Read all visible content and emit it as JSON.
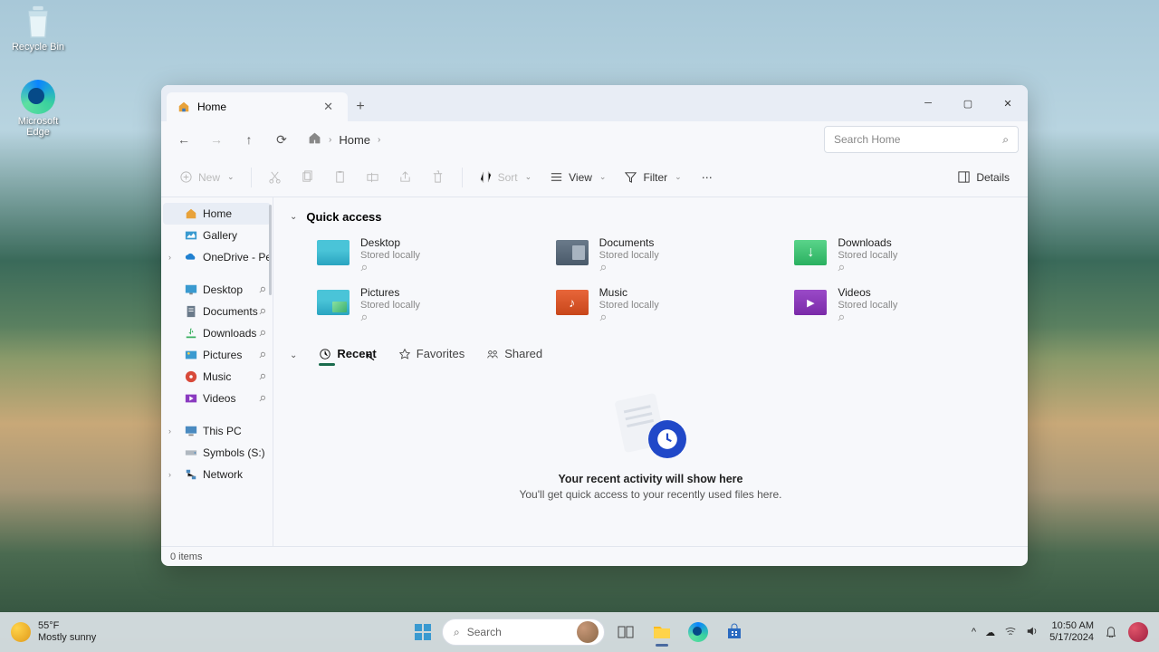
{
  "desktop_icons": {
    "recycle_bin": "Recycle Bin",
    "edge": "Microsoft Edge"
  },
  "window": {
    "tab_title": "Home",
    "breadcrumb": {
      "path": "Home"
    },
    "search_placeholder": "Search Home",
    "toolbar": {
      "new": "New",
      "sort": "Sort",
      "view": "View",
      "filter": "Filter",
      "details": "Details"
    },
    "sidebar": {
      "home": "Home",
      "gallery": "Gallery",
      "onedrive": "OneDrive - Perso",
      "desktop": "Desktop",
      "documents": "Documents",
      "downloads": "Downloads",
      "pictures": "Pictures",
      "music": "Music",
      "videos": "Videos",
      "thispc": "This PC",
      "symbols": "Symbols (S:)",
      "network": "Network"
    },
    "content": {
      "quick_access_title": "Quick access",
      "stored_locally": "Stored locally",
      "folders": {
        "desktop": "Desktop",
        "documents": "Documents",
        "downloads": "Downloads",
        "pictures": "Pictures",
        "music": "Music",
        "videos": "Videos"
      },
      "tabs": {
        "recent": "Recent",
        "favorites": "Favorites",
        "shared": "Shared"
      },
      "empty": {
        "line1": "Your recent activity will show here",
        "line2": "You'll get quick access to your recently used files here."
      }
    },
    "status": {
      "items": "0 items"
    }
  },
  "taskbar": {
    "weather_temp": "55°F",
    "weather_desc": "Mostly sunny",
    "search": "Search",
    "time": "10:50 AM",
    "date": "5/17/2024"
  }
}
